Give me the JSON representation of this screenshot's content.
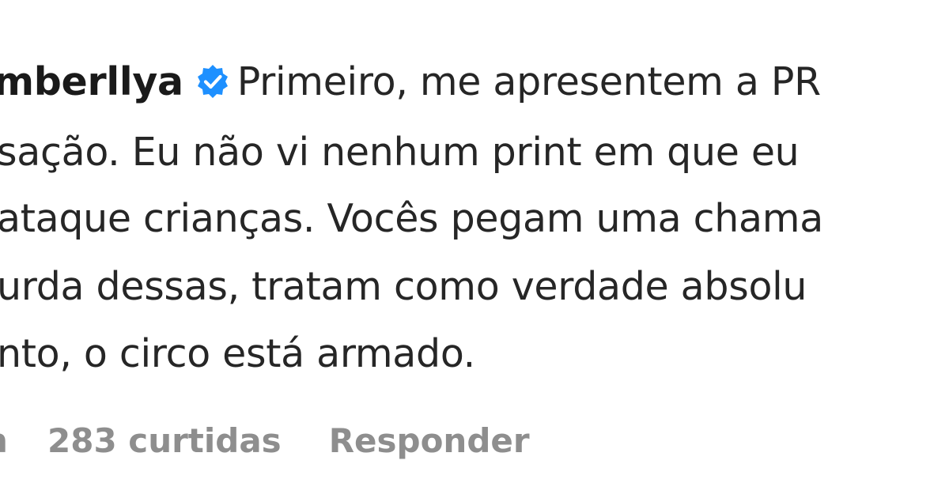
{
  "comment": {
    "username": "mberllya",
    "verified_icon": "verified-badge-icon",
    "badge_color": "#1e90ff",
    "lines": [
      "Primeiro, me apresentem a PR",
      "sação. Eu não vi nenhum print em que eu",
      "ataque crianças. Vocês pegam uma chama",
      "urda dessas, tratam como verdade absolu",
      "nto, o circo está armado."
    ]
  },
  "actions": {
    "time_fragment": "h",
    "likes_label": "283 curtidas",
    "reply_label": "Responder"
  }
}
